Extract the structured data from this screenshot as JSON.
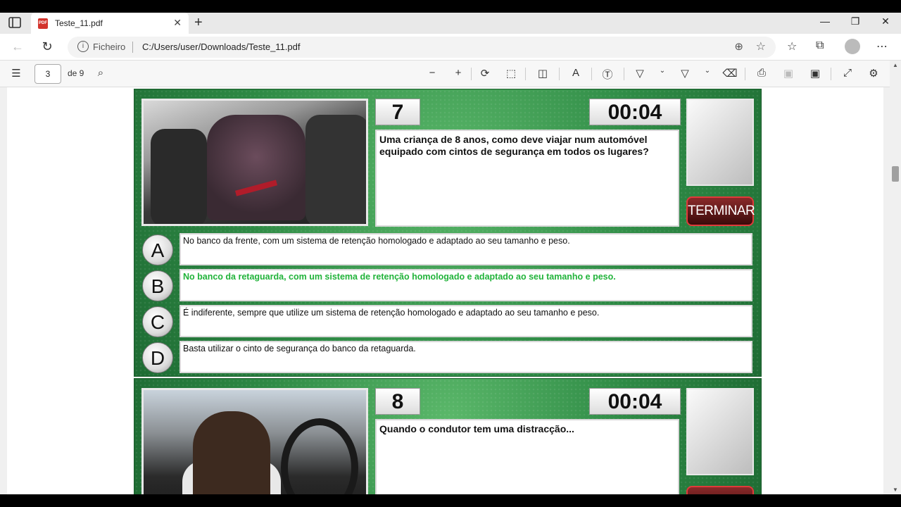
{
  "browser": {
    "tab_title": "Teste_11.pdf",
    "tab_close": "✕",
    "new_tab": "+",
    "address_label": "Ficheiro",
    "url": "C:/Users/user/Downloads/Teste_11.pdf"
  },
  "pdf_toolbar": {
    "page_current": "3",
    "page_total_label": "de 9"
  },
  "questions": [
    {
      "number": "7",
      "timer": "00:04",
      "text": "Uma criança de 8 anos, como deve viajar num automóvel equipado com cintos de segurança em todos os lugares?",
      "end_button": "TERMINAR",
      "options": [
        {
          "letter": "A",
          "text": "No banco da frente, com um sistema de retenção homologado e adaptado ao seu tamanho e peso.",
          "correct": false
        },
        {
          "letter": "B",
          "text": "No banco da retaguarda, com um sistema de retenção homologado e adaptado ao seu tamanho e peso.",
          "correct": true
        },
        {
          "letter": "C",
          "text": "É indiferente, sempre que utilize um sistema de retenção homologado e adaptado ao seu tamanho e peso.",
          "correct": false
        },
        {
          "letter": "D",
          "text": "Basta utilizar o cinto de segurança do banco da retaguarda.",
          "correct": false
        }
      ]
    },
    {
      "number": "8",
      "timer": "00:04",
      "text": "Quando o condutor tem uma distracção..."
    }
  ],
  "colors": {
    "correct_answer": "#21b33a",
    "card_green": "#2e8a45",
    "end_button_border": "#e03a3a"
  }
}
